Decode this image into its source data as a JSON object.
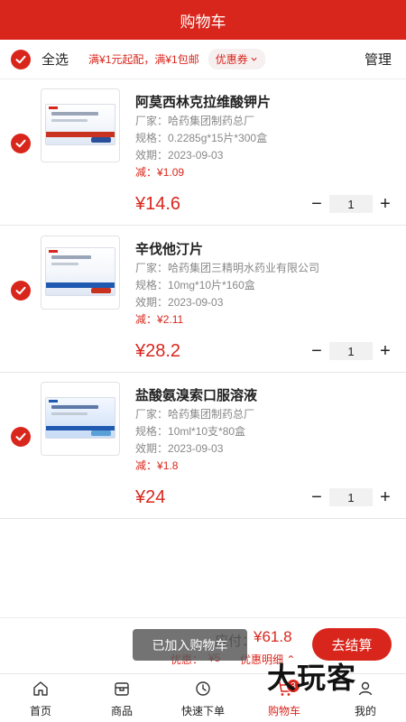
{
  "header": {
    "title": "购物车"
  },
  "toolbar": {
    "select_all": "全选",
    "promo": "满¥1元起配，满¥1包邮",
    "coupon": "优惠券",
    "manage": "管理"
  },
  "labels": {
    "manufacturer": "厂家：",
    "spec": "规格：",
    "expiry": "效期：",
    "reduce": "减："
  },
  "items": [
    {
      "name": "阿莫西林克拉维酸钾片",
      "manufacturer": "哈药集团制药总厂",
      "spec": "0.2285g*15片*300盒",
      "expiry": "2023-09-03",
      "reduce": "¥1.09",
      "price": "¥14.6",
      "qty": "1"
    },
    {
      "name": "辛伐他汀片",
      "manufacturer": "哈药集团三精明水药业有限公司",
      "spec": "10mg*10片*160盒",
      "expiry": "2023-09-03",
      "reduce": "¥2.11",
      "price": "¥28.2",
      "qty": "1"
    },
    {
      "name": "盐酸氨溴索口服溶液",
      "manufacturer": "哈药集团制药总厂",
      "spec": "10ml*10支*80盒",
      "expiry": "2023-09-03",
      "reduce": "¥1.8",
      "price": "¥24",
      "qty": "1"
    }
  ],
  "checkout": {
    "pay_label": "应付：",
    "pay_value": "¥61.8",
    "discount_label": "优惠：",
    "discount_value": "¥5",
    "discount_detail": "优惠明细",
    "button": "去结算"
  },
  "toast": "已加入购物车",
  "tabs": [
    {
      "label": "首页",
      "icon": "home-icon"
    },
    {
      "label": "商品",
      "icon": "goods-icon"
    },
    {
      "label": "快速下单",
      "icon": "quick-order-icon"
    },
    {
      "label": "购物车",
      "icon": "cart-icon",
      "badge": "3"
    },
    {
      "label": "我的",
      "icon": "user-icon"
    }
  ],
  "watermark": "大玩客",
  "colors": {
    "primary": "#d9261c",
    "text": "#222222",
    "muted": "#888888"
  }
}
